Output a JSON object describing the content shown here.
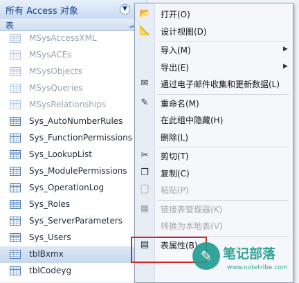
{
  "nav_pane": {
    "title": "所有 Access 对象",
    "dropdown_icon": "chevron-down-circle-icon",
    "group": {
      "label": "表",
      "collapse_icon": "double-chevron-up-icon"
    },
    "tables": [
      {
        "name": "MSysAccessXML",
        "system": true
      },
      {
        "name": "MSysACEs",
        "system": true
      },
      {
        "name": "MSysObjects",
        "system": true
      },
      {
        "name": "MSysQueries",
        "system": true
      },
      {
        "name": "MSysRelationships",
        "system": true
      },
      {
        "name": "Sys_AutoNumberRules",
        "system": false
      },
      {
        "name": "Sys_FunctionPermissions",
        "system": false
      },
      {
        "name": "Sys_LookupList",
        "system": false
      },
      {
        "name": "Sys_ModulePermissions",
        "system": false
      },
      {
        "name": "Sys_OperationLog",
        "system": false
      },
      {
        "name": "Sys_Roles",
        "system": false
      },
      {
        "name": "Sys_ServerParameters",
        "system": false
      },
      {
        "name": "Sys_Users",
        "system": false
      },
      {
        "name": "tblBxmx",
        "system": false,
        "selected": true
      },
      {
        "name": "tblCodeyg",
        "system": false
      }
    ]
  },
  "context_menu": {
    "items": [
      {
        "label": "打开(O)",
        "icon": "open-icon",
        "glyph": "📂",
        "enabled": true
      },
      {
        "label": "设计视图(D)",
        "icon": "design-view-icon",
        "glyph": "📐",
        "enabled": true
      },
      {
        "separator": true
      },
      {
        "label": "导入(M)",
        "enabled": true,
        "submenu": true
      },
      {
        "label": "导出(E)",
        "enabled": true,
        "submenu": true
      },
      {
        "label": "通过电子邮件收集和更新数据(L)",
        "icon": "email-collect-icon",
        "glyph": "✉",
        "enabled": true
      },
      {
        "separator": true
      },
      {
        "label": "重命名(M)",
        "icon": "rename-icon",
        "glyph": "✎",
        "enabled": true
      },
      {
        "label": "在此组中隐藏(H)",
        "enabled": true
      },
      {
        "label": "删除(L)",
        "enabled": true
      },
      {
        "separator": true
      },
      {
        "label": "剪切(T)",
        "icon": "scissors-icon",
        "glyph": "✂",
        "enabled": true
      },
      {
        "label": "复制(C)",
        "icon": "copy-icon",
        "glyph": "❐",
        "enabled": true
      },
      {
        "label": "粘贴(P)",
        "icon": "paste-icon",
        "glyph": "📋",
        "enabled": false
      },
      {
        "separator": true
      },
      {
        "label": "链接表管理器(K)",
        "icon": "linked-table-manager-icon",
        "glyph": "▦",
        "enabled": false
      },
      {
        "label": "转换为本地表(V)",
        "enabled": false
      },
      {
        "separator": true
      },
      {
        "label": "表属性(B)",
        "icon": "table-properties-icon",
        "glyph": "▤",
        "enabled": true
      }
    ]
  },
  "watermark": {
    "title": "笔记部落",
    "url": "www.notetribe.com",
    "logo_icon": "feather-pen-logo"
  },
  "colors": {
    "highlight_box": "#d8231f",
    "watermark": "#1a9a8c"
  }
}
